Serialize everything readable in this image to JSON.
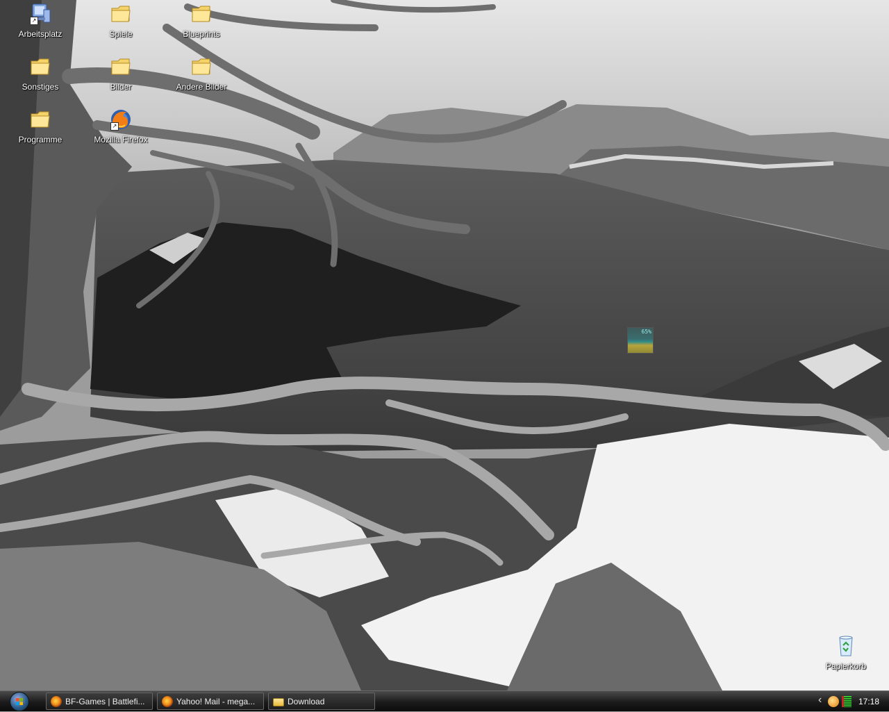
{
  "desktop": {
    "icons": [
      {
        "label": "Arbeitsplatz",
        "icon": "computer-icon"
      },
      {
        "label": "Spiele",
        "icon": "folder-icon"
      },
      {
        "label": "Blueprints",
        "icon": "folder-icon"
      },
      {
        "label": "Sonstiges",
        "icon": "folder-icon"
      },
      {
        "label": "Bilder",
        "icon": "folder-icon"
      },
      {
        "label": "Andere Bilder",
        "icon": "folder-icon"
      },
      {
        "label": "Programme",
        "icon": "folder-icon"
      },
      {
        "label": "Mozilla Firefox",
        "icon": "firefox-icon"
      },
      {
        "label": "Papierkorb",
        "icon": "recycle-bin-icon"
      }
    ],
    "gadget_label": "65%"
  },
  "taskbar": {
    "start_icon": "windows-orb-icon",
    "tasks": [
      {
        "label": "BF-Games | Battlefi...",
        "icon": "firefox-icon"
      },
      {
        "label": "Yahoo! Mail - mega...",
        "icon": "firefox-icon"
      },
      {
        "label": "Download",
        "icon": "folder-icon"
      }
    ],
    "tray": {
      "expand_glyph": "‹",
      "icons": [
        "media-player-icon",
        "network-status-icon"
      ],
      "clock": "17:18"
    }
  }
}
